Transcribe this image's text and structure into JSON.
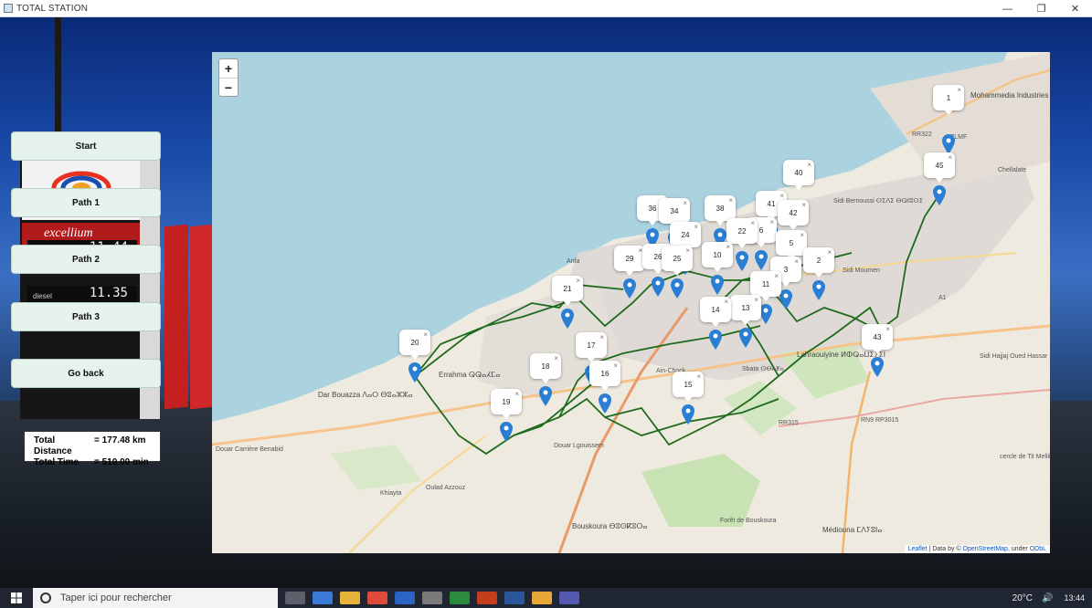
{
  "window": {
    "title": "TOTAL STATION",
    "minimize": "—",
    "maximize": "❐",
    "close": "✕"
  },
  "sidebar": {
    "buttons": [
      {
        "id": "start",
        "label": "Start"
      },
      {
        "id": "path1",
        "label": "Path 1"
      },
      {
        "id": "path2",
        "label": "Path 2"
      },
      {
        "id": "path3",
        "label": "Path 3"
      },
      {
        "id": "goback",
        "label": "Go back"
      }
    ],
    "stats": {
      "distance_label": "Total Distance",
      "distance_value": "= 177.48 km",
      "time_label": "Total Time",
      "time_value": "= 510.00 min"
    }
  },
  "background_sign": {
    "brand_text": "excellium",
    "price_1": "11.44",
    "price_2": "11.35",
    "fuel_label": "diesel"
  },
  "map": {
    "zoom_in": "+",
    "zoom_out": "−",
    "attribution": {
      "leaflet": "Leaflet",
      "data_by": " | Data by © ",
      "osm": "OpenStreetMap",
      "under": ", under ",
      "odbl": "ODbL"
    },
    "places": [
      {
        "name": "Mohammedia Industries"
      },
      {
        "name": "Sidi Bernoussi ⵙⵉⴷⵉ ⴱⵕⵏⵓⵙⵉ"
      },
      {
        "name": "Chellalate"
      },
      {
        "name": "Sidi Moumen"
      },
      {
        "name": "Anfa"
      },
      {
        "name": "Errahma ⵕⵕⴰⵃⵎⴰ"
      },
      {
        "name": "Dar Bouazza ⴷⴰⵔ ⴱⵓⴰⵣⵣⴰ"
      },
      {
        "name": "Ain-Chock"
      },
      {
        "name": "Sbata ⵙⴱⴰⵟⴰ"
      },
      {
        "name": "Lahraouiyine ⵍⵀⵕⴰⵡⵉⵢⵉⵏ"
      },
      {
        "name": "Sidi Hajjaj Oued Hassar"
      },
      {
        "name": "Douar Lgouissem"
      },
      {
        "name": "Oulad Azzouz"
      },
      {
        "name": "Bouskoura ⴱⵓⵙⴽⵓⵔⴰ"
      },
      {
        "name": "Forêt de Bouskoura"
      },
      {
        "name": "Médiouna ⵎⴷⵢⵓⵏⴰ"
      },
      {
        "name": "Douar Carrière Benabid"
      },
      {
        "name": "Khiayta"
      },
      {
        "name": "RR322"
      },
      {
        "name": "RR315"
      },
      {
        "name": "RN9 RP3015"
      },
      {
        "name": "A1"
      },
      {
        "name": "cercle de Tit Mellil"
      },
      {
        "name": "ZLMF"
      }
    ],
    "markers": [
      {
        "label": "1"
      },
      {
        "label": "45"
      },
      {
        "label": "40"
      },
      {
        "label": "41"
      },
      {
        "label": "42"
      },
      {
        "label": "6"
      },
      {
        "label": "5"
      },
      {
        "label": "3"
      },
      {
        "label": "2"
      },
      {
        "label": "38"
      },
      {
        "label": "22"
      },
      {
        "label": "36"
      },
      {
        "label": "34"
      },
      {
        "label": "24"
      },
      {
        "label": "10"
      },
      {
        "label": "29"
      },
      {
        "label": "26"
      },
      {
        "label": "25"
      },
      {
        "label": "11"
      },
      {
        "label": "13"
      },
      {
        "label": "14"
      },
      {
        "label": "21"
      },
      {
        "label": "20"
      },
      {
        "label": "17"
      },
      {
        "label": "18"
      },
      {
        "label": "16"
      },
      {
        "label": "19"
      },
      {
        "label": "15"
      },
      {
        "label": "43"
      }
    ],
    "marker_close": "×"
  },
  "taskbar": {
    "search_placeholder": "Taper ici pour rechercher",
    "weather": "20°C",
    "time": "13:44"
  },
  "colors": {
    "route": "#1e6b1e",
    "marker": "#2a7fd4",
    "sea": "#aad3df",
    "button": "#e6f2ec"
  }
}
